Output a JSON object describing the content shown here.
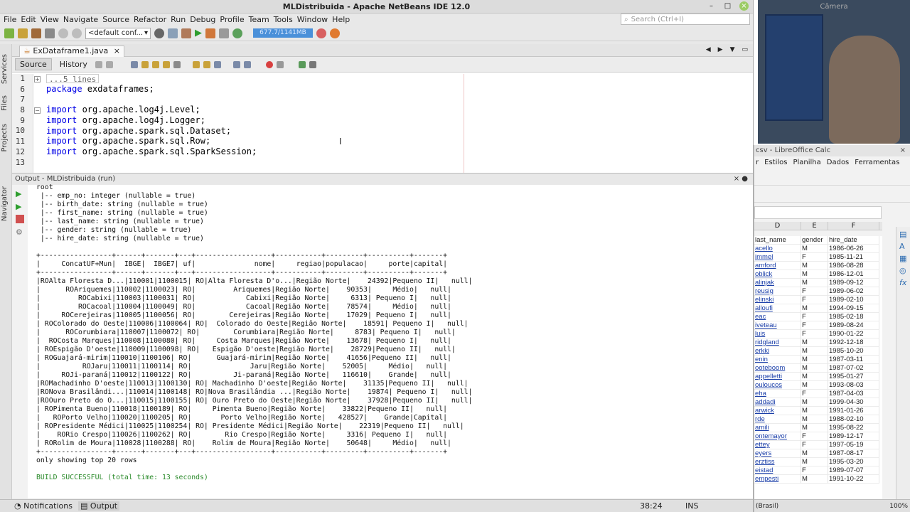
{
  "window": {
    "title": "MLDistribuida - Apache NetBeans IDE 12.0"
  },
  "menu": [
    "File",
    "Edit",
    "View",
    "Navigate",
    "Source",
    "Refactor",
    "Run",
    "Debug",
    "Profile",
    "Team",
    "Tools",
    "Window",
    "Help"
  ],
  "search": {
    "placeholder": "Search (Ctrl+I)"
  },
  "toolbar": {
    "config": "<default conf...",
    "memory": "677.7/1141MB"
  },
  "sidebar": {
    "services": "Services",
    "files": "Files",
    "projects": "Projects",
    "navigator": "Navigator"
  },
  "editor": {
    "tab": "ExDataframe1.java",
    "source_label": "Source",
    "history_label": "History",
    "line_numbers": [
      "1",
      "6",
      "7",
      "8",
      "9",
      "10",
      "11",
      "12",
      "13"
    ],
    "lines": [
      {
        "kw": "",
        "text": "...5 lines"
      },
      {
        "kw": "package",
        "text": " exdataframes;"
      },
      {
        "kw": "",
        "text": ""
      },
      {
        "kw": "import",
        "text": " org.apache.log4j.Level;"
      },
      {
        "kw": "import",
        "text": " org.apache.log4j.Logger;"
      },
      {
        "kw": "import",
        "text": " org.apache.spark.sql.Dataset;"
      },
      {
        "kw": "import",
        "text": " org.apache.spark.sql.Row;"
      },
      {
        "kw": "import",
        "text": " org.apache.spark.sql.SparkSession;"
      },
      {
        "kw": "",
        "text": ""
      }
    ]
  },
  "output": {
    "title": "Output - MLDistribuida (run)",
    "schema": [
      "root",
      " |-- emp_no: integer (nullable = true)",
      " |-- birth_date: string (nullable = true)",
      " |-- first_name: string (nullable = true)",
      " |-- last_name: string (nullable = true)",
      " |-- gender: string (nullable = true)",
      " |-- hire_date: string (nullable = true)"
    ],
    "separator": "+-----------------+------+-------+---+------------------+-----------+---------+----------+-------+",
    "header": "|     ConcatUF+Mun|  IBGE|  IBGE7| uf|              nome|     regiao|populacao|     porte|capital|",
    "rows": [
      "|ROAlta Floresta D...|110001|1100015| RO|Alta Floresta D'o...|Região Norte|    24392|Pequeno II|   null|",
      "|      ROAriquemes|110002|1100023| RO|         Ariquemes|Região Norte|    90353|     Médio|   null|",
      "|         ROCabixi|110003|1100031| RO|            Cabixi|Região Norte|     6313| Pequeno I|   null|",
      "|         ROCacoal|110004|1100049| RO|            Cacoal|Região Norte|    78574|     Médio|   null|",
      "|     ROCerejeiras|110005|1100056| RO|        Cerejeiras|Região Norte|    17029| Pequeno I|   null|",
      "| ROColorado do Oeste|110006|1100064| RO|  Colorado do Oeste|Região Norte|    18591| Pequeno I|   null|",
      "|      ROCorumbiara|110007|1100072| RO|        Corumbiara|Região Norte|     8783| Pequeno I|   null|",
      "|  ROCosta Marques|110008|1100080| RO|     Costa Marques|Região Norte|    13678| Pequeno I|   null|",
      "| ROEspigão D'oeste|110009|1100098| RO|   Espigão D'oeste|Região Norte|    28729|Pequeno II|   null|",
      "| ROGuajará-mirim|110010|1100106| RO|      Guajará-mirim|Região Norte|    41656|Pequeno II|   null|",
      "|          ROJaru|110011|1100114| RO|              Jaru|Região Norte|    52005|     Médio|   null|",
      "|     ROJi-paraná|110012|1100122| RO|          Ji-paraná|Região Norte|   116610|    Grande|   null|",
      "|ROMachadinho D'oeste|110013|1100130| RO| Machadinho D'oeste|Região Norte|    31135|Pequeno II|   null|",
      "|RONova Brasilândi...|110014|1100148| RO|Nova Brasilândia ...|Região Norte|    19874| Pequeno I|   null|",
      "|ROOuro Preto do O...|110015|1100155| RO| Ouro Preto do Oeste|Região Norte|    37928|Pequeno II|   null|",
      "| ROPimenta Bueno|110018|1100189| RO|     Pimenta Bueno|Região Norte|    33822|Pequeno II|   null|",
      "|   ROPorto Velho|110020|1100205| RO|       Porto Velho|Região Norte|   428527|    Grande|Capital|",
      "| ROPresidente Médici|110025|1100254| RO| Presidente Médici|Região Norte|    22319|Pequeno II|   null|",
      "|    RORio Crespo|110026|1100262| RO|        Rio Crespo|Região Norte|     3316| Pequeno I|   null|",
      "| RORolim de Moura|110028|1100288| RO|    Rolim de Moura|Região Norte|    50648|     Médio|   null|"
    ],
    "footer": "only showing top 20 rows",
    "build": "BUILD SUCCESSFUL (total time: 13 seconds)"
  },
  "statusbar": {
    "notifications": "Notifications",
    "output": "Output",
    "position": "38:24",
    "mode": "INS"
  },
  "camera": {
    "label": "Câmera"
  },
  "calc": {
    "title": "csv - LibreOffice Calc",
    "menu": [
      "r",
      "Estilos",
      "Planilha",
      "Dados",
      "Ferramentas"
    ],
    "columns": [
      "D",
      "E",
      "F"
    ],
    "header": [
      "last_name",
      "gender",
      "hire_date"
    ],
    "rows": [
      [
        "acello",
        "M",
        "1986-06-26"
      ],
      [
        "immel",
        "F",
        "1985-11-21"
      ],
      [
        "amford",
        "M",
        "1986-08-28"
      ],
      [
        "oblick",
        "M",
        "1986-12-01"
      ],
      [
        "alinjak",
        "M",
        "1989-09-12"
      ],
      [
        "reusig",
        "F",
        "1989-06-02"
      ],
      [
        "elinski",
        "F",
        "1989-02-10"
      ],
      [
        "alloufi",
        "M",
        "1994-09-15"
      ],
      [
        "eac",
        "F",
        "1985-02-18"
      ],
      [
        "iveteau",
        "F",
        "1989-08-24"
      ],
      [
        "luis",
        "F",
        "1990-01-22"
      ],
      [
        "ridgland",
        "M",
        "1992-12-18"
      ],
      [
        "erkki",
        "M",
        "1985-10-20"
      ],
      [
        "enin",
        "M",
        "1987-03-11"
      ],
      [
        "ooteboom",
        "M",
        "1987-07-02"
      ],
      [
        "appelletti",
        "M",
        "1995-01-27"
      ],
      [
        "ouloucos",
        "M",
        "1993-08-03"
      ],
      [
        "eha",
        "F",
        "1987-04-03"
      ],
      [
        "addadi",
        "M",
        "1999-04-30"
      ],
      [
        "arwick",
        "M",
        "1991-01-26"
      ],
      [
        "rde",
        "M",
        "1988-02-10"
      ],
      [
        "amili",
        "M",
        "1995-08-22"
      ],
      [
        "ontemayor",
        "F",
        "1989-12-17"
      ],
      [
        "ettey",
        "F",
        "1997-05-19"
      ],
      [
        "eyers",
        "M",
        "1987-08-17"
      ],
      [
        "erztiss",
        "M",
        "1995-03-20"
      ],
      [
        "eistad",
        "F",
        "1989-07-07"
      ],
      [
        "empesti",
        "M",
        "1991-10-22"
      ]
    ],
    "status_lang": "(Brasil)",
    "zoom": "100%"
  }
}
